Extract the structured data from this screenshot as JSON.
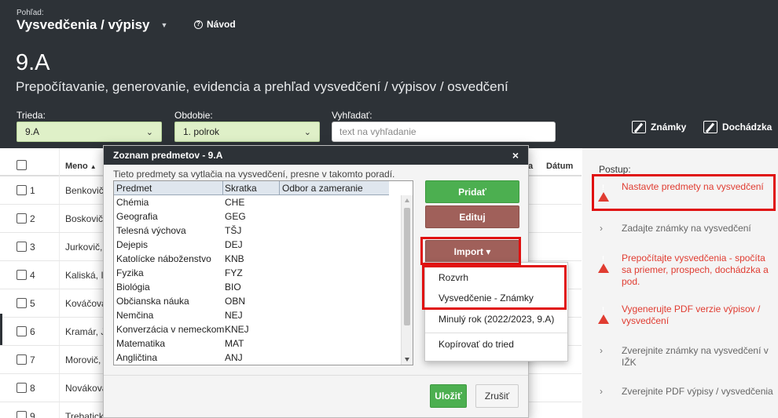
{
  "header": {
    "view_label": "Pohľad:",
    "view_title": "Vysvedčenia / výpisy",
    "help": "Návod",
    "class_title": "9.A",
    "subtitle": "Prepočítavanie, generovanie, evidencia a prehľad vysvedčení / výpisov / osvedčení",
    "filters": {
      "trieda_label": "Trieda:",
      "trieda_value": "9.A",
      "obdobie_label": "Obdobie:",
      "obdobie_value": "1. polrok",
      "search_label": "Vyhľadať:",
      "search_placeholder": "text na vyhľadanie"
    },
    "buttons": {
      "znamky": "Známky",
      "dochadzka": "Dochádzka"
    }
  },
  "table": {
    "col_name": "Meno",
    "col_sort": "▲",
    "col_a": "a",
    "col_date": "Dátum",
    "rows": [
      {
        "num": "1",
        "name": "Benkovič"
      },
      {
        "num": "2",
        "name": "Boskovič"
      },
      {
        "num": "3",
        "name": "Jurkovič,"
      },
      {
        "num": "4",
        "name": "Kaliská, I"
      },
      {
        "num": "5",
        "name": "Kováčova"
      },
      {
        "num": "6",
        "name": "Kramár, J"
      },
      {
        "num": "7",
        "name": "Morovič,"
      },
      {
        "num": "8",
        "name": "Novákova"
      },
      {
        "num": "9",
        "name": "Trebatick"
      }
    ]
  },
  "panel": {
    "title": "Postup:",
    "steps": [
      {
        "text": "Nastavte predmety na vysvedčení",
        "status": "warn"
      },
      {
        "text": "Zadajte známky na vysvedčení",
        "status": "todo"
      },
      {
        "text": "Prepočítajte vysvedčenia - spočíta sa priemer, prospech, dochádzka a pod.",
        "status": "warn"
      },
      {
        "text": "Vygenerujte PDF verzie výpisov / vysvedčení",
        "status": "warn"
      },
      {
        "text": "Zverejnite známky na vysvedčení v IŽK",
        "status": "todo"
      },
      {
        "text": "Zverejnite PDF výpisy / vysvedčenia",
        "status": "todo"
      }
    ]
  },
  "modal": {
    "title": "Zoznam predmetov - 9.A",
    "close": "×",
    "description": "Tieto predmety sa vytlačia na vysvedčení, presne v takomto poradí.",
    "columns": [
      "Predmet",
      "Skratka",
      "Odbor a zameranie"
    ],
    "subjects": [
      {
        "name": "Chémia",
        "abbr": "CHE"
      },
      {
        "name": "Geografia",
        "abbr": "GEG"
      },
      {
        "name": "Telesná výchova",
        "abbr": "TŠJ"
      },
      {
        "name": "Dejepis",
        "abbr": "DEJ"
      },
      {
        "name": "Katolícke náboženstvo",
        "abbr": "KNB"
      },
      {
        "name": "Fyzika",
        "abbr": "FYZ"
      },
      {
        "name": "Biológia",
        "abbr": "BIO"
      },
      {
        "name": "Občianska náuka",
        "abbr": "OBN"
      },
      {
        "name": "Nemčina",
        "abbr": "NEJ"
      },
      {
        "name": "Konverzácia v nemeckom",
        "abbr": "KNEJ"
      },
      {
        "name": "Matematika",
        "abbr": "MAT"
      },
      {
        "name": "Angličtina",
        "abbr": "ANJ"
      }
    ],
    "add": "Pridať",
    "edit": "Edituj",
    "import": "Import ▾",
    "import_menu": [
      "Rozvrh",
      "Vysvedčenie - Známky",
      "Minulý rok (2022/2023, 9.A)",
      "Kopírovať do tried"
    ],
    "save": "Uložiť",
    "cancel": "Zrušiť"
  },
  "colors": {
    "header_bg": "#2d3237",
    "accent_green": "#4caf50",
    "accent_brown": "#a0605a",
    "warn_red": "#e03c31",
    "highlight_red": "#e01010"
  }
}
